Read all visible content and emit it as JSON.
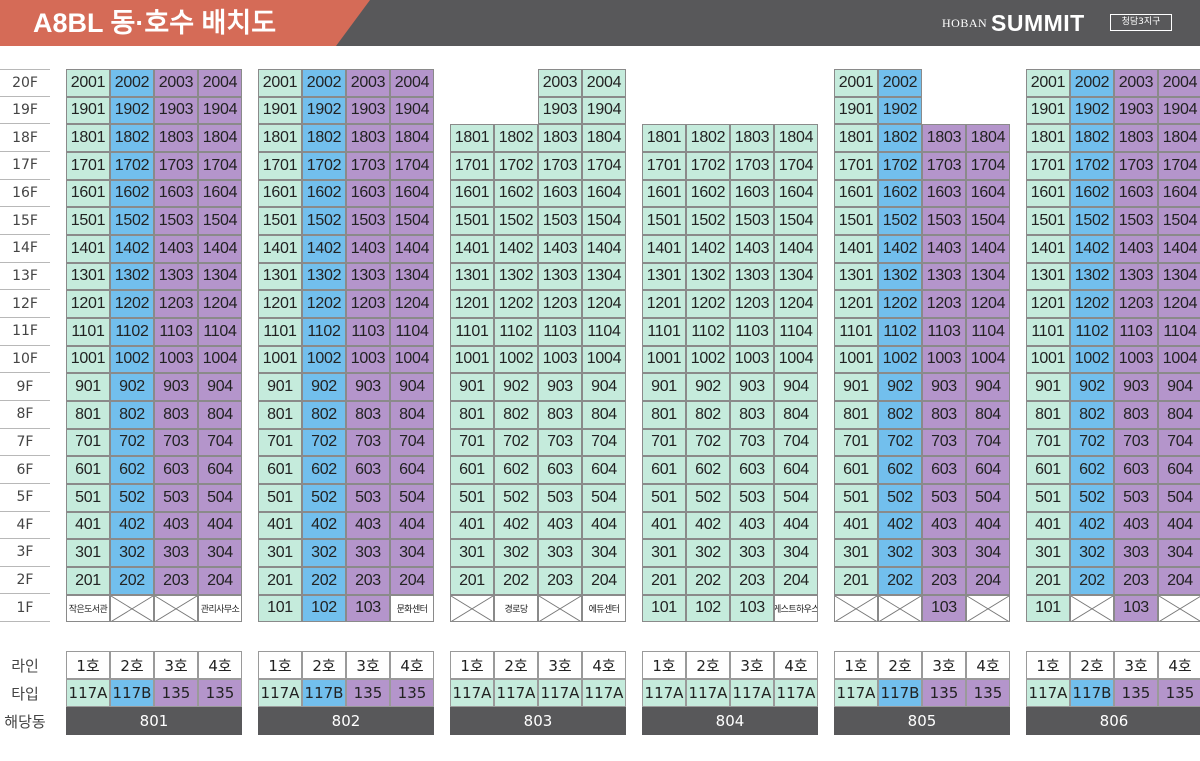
{
  "header": {
    "title": "A8BL 동·호수 배치도",
    "brand_small": "HOBAN",
    "brand_main": "SUMMIT",
    "brand_tag": "청담3지구"
  },
  "colors": {
    "line1": "#c5ebdc",
    "line2": "#72bfed",
    "line3": "#b495cb",
    "header_bg": "#58585a",
    "title_bg": "#d56b57"
  },
  "floors": [
    "20F",
    "19F",
    "18F",
    "17F",
    "16F",
    "15F",
    "14F",
    "13F",
    "12F",
    "11F",
    "10F",
    "9F",
    "8F",
    "7F",
    "6F",
    "5F",
    "4F",
    "3F",
    "2F",
    "1F"
  ],
  "row_labels": {
    "line": "라인",
    "type": "타입",
    "dong": "해당동"
  },
  "buildings": [
    {
      "dong": "801",
      "top_floor": [
        20,
        20,
        20,
        20
      ],
      "colors": [
        "c0",
        "c1",
        "c2",
        "c2"
      ],
      "first_floor": [
        {
          "text": "작은도서관",
          "kind": "fac"
        },
        {
          "kind": "x"
        },
        {
          "kind": "x"
        },
        {
          "text": "관리사무소",
          "kind": "fac"
        }
      ],
      "lines": [
        "1호",
        "2호",
        "3호",
        "4호"
      ],
      "types": [
        "117A",
        "117B",
        "135",
        "135"
      ],
      "type_colors": [
        "c0",
        "c1",
        "c2",
        "c2"
      ]
    },
    {
      "dong": "802",
      "top_floor": [
        20,
        20,
        20,
        20
      ],
      "colors": [
        "c0",
        "c1",
        "c2",
        "c2"
      ],
      "first_floor": [
        {
          "text": "101",
          "kind": "unit"
        },
        {
          "text": "102",
          "kind": "unit"
        },
        {
          "text": "103",
          "kind": "unit"
        },
        {
          "text": "문화센터",
          "kind": "fac"
        }
      ],
      "lines": [
        "1호",
        "2호",
        "3호",
        "4호"
      ],
      "types": [
        "117A",
        "117B",
        "135",
        "135"
      ],
      "type_colors": [
        "c0",
        "c1",
        "c2",
        "c2"
      ]
    },
    {
      "dong": "803",
      "top_floor": [
        18,
        18,
        20,
        20
      ],
      "colors": [
        "c0",
        "c0",
        "c0",
        "c0"
      ],
      "first_floor": [
        {
          "kind": "x"
        },
        {
          "text": "경로당",
          "kind": "fac"
        },
        {
          "kind": "x"
        },
        {
          "text": "에듀센터",
          "kind": "fac"
        }
      ],
      "lines": [
        "1호",
        "2호",
        "3호",
        "4호"
      ],
      "types": [
        "117A",
        "117A",
        "117A",
        "117A"
      ],
      "type_colors": [
        "c0",
        "c0",
        "c0",
        "c0"
      ]
    },
    {
      "dong": "804",
      "top_floor": [
        18,
        18,
        18,
        18
      ],
      "colors": [
        "c0",
        "c0",
        "c0",
        "c0"
      ],
      "first_floor": [
        {
          "text": "101",
          "kind": "unit"
        },
        {
          "text": "102",
          "kind": "unit"
        },
        {
          "text": "103",
          "kind": "unit"
        },
        {
          "text": "게스트하우스",
          "kind": "fac"
        }
      ],
      "lines": [
        "1호",
        "2호",
        "3호",
        "4호"
      ],
      "types": [
        "117A",
        "117A",
        "117A",
        "117A"
      ],
      "type_colors": [
        "c0",
        "c0",
        "c0",
        "c0"
      ]
    },
    {
      "dong": "805",
      "top_floor": [
        20,
        20,
        18,
        18
      ],
      "colors": [
        "c0",
        "c1",
        "c2",
        "c2"
      ],
      "first_floor": [
        {
          "kind": "x"
        },
        {
          "kind": "x"
        },
        {
          "text": "103",
          "kind": "unit"
        },
        {
          "kind": "x"
        }
      ],
      "lines": [
        "1호",
        "2호",
        "3호",
        "4호"
      ],
      "types": [
        "117A",
        "117B",
        "135",
        "135"
      ],
      "type_colors": [
        "c0",
        "c1",
        "c2",
        "c2"
      ]
    },
    {
      "dong": "806",
      "top_floor": [
        20,
        20,
        20,
        20
      ],
      "colors": [
        "c0",
        "c1",
        "c2",
        "c2"
      ],
      "first_floor": [
        {
          "text": "101",
          "kind": "unit"
        },
        {
          "kind": "x"
        },
        {
          "text": "103",
          "kind": "unit"
        },
        {
          "kind": "x"
        }
      ],
      "lines": [
        "1호",
        "2호",
        "3호",
        "4호"
      ],
      "types": [
        "117A",
        "117B",
        "135",
        "135"
      ],
      "type_colors": [
        "c0",
        "c1",
        "c2",
        "c2"
      ]
    }
  ]
}
